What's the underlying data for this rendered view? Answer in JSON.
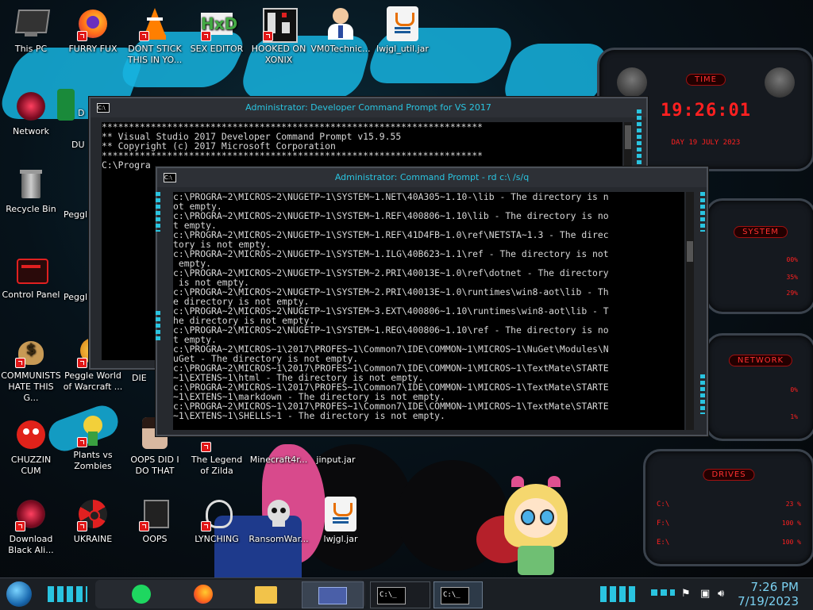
{
  "desktop": {
    "icons": [
      {
        "label": "This PC",
        "icon": "monitor-icon"
      },
      {
        "label": "FURRY FUX",
        "icon": "firefox-icon"
      },
      {
        "label": "DONT STICK THIS IN YO...",
        "icon": "vlc-icon"
      },
      {
        "label": "SEX EDITOR",
        "icon": "hxd-icon"
      },
      {
        "label": "HOOKED ON XONIX",
        "icon": "xonix-icon"
      },
      {
        "label": "VM0Technic...",
        "icon": "doctor-icon"
      },
      {
        "label": "lwjgl_util.jar",
        "icon": "java-jar-icon"
      },
      {
        "label": "Network",
        "icon": "network-icon"
      },
      {
        "label": "Recycle Bin",
        "icon": "recycle-bin-icon"
      },
      {
        "label": "Control Panel",
        "icon": "control-panel-icon"
      },
      {
        "label": "COMMUNISTS HATE THIS G...",
        "icon": "money-bag-icon"
      },
      {
        "label": "Peggle World of Warcraft ...",
        "icon": "peggle-icon"
      },
      {
        "label": "CHUZZIN CUM",
        "icon": "chuzzle-icon"
      },
      {
        "label": "Plants vs Zombies",
        "icon": "plants-icon"
      },
      {
        "label": "OOPS DID I DO THAT",
        "icon": "portrait-icon"
      },
      {
        "label": "The Legend of Zilda",
        "icon": "zelda-icon"
      },
      {
        "label": "Minecraft4r...",
        "icon": "minecraft-icon"
      },
      {
        "label": "jinput.jar",
        "icon": "java-jar-icon"
      },
      {
        "label": "Download Black Ali...",
        "icon": "alienware-icon"
      },
      {
        "label": "UKRAINE",
        "icon": "radiation-icon"
      },
      {
        "label": "OOPS",
        "icon": "oops-icon"
      },
      {
        "label": "LYNCHING",
        "icon": "lynching-icon"
      },
      {
        "label": "RansomWar...",
        "icon": "skull-icon"
      },
      {
        "label": "lwjgl.jar",
        "icon": "java-jar-icon"
      }
    ],
    "partial_labels": [
      "D",
      "DU",
      "Peggl",
      "Peggl",
      "DIE"
    ]
  },
  "gadgets": {
    "time": {
      "title": "TIME",
      "clock": "19:26:01",
      "date": "DAY 19 JULY 2023"
    },
    "system": {
      "title": "SYSTEM",
      "values": [
        "00%",
        "35%",
        "29%"
      ]
    },
    "network": {
      "title": "NETWORK",
      "values": [
        "0%",
        "1%"
      ]
    },
    "drives": {
      "title": "DRIVES",
      "rows": [
        {
          "label": "C:\\",
          "value": "23 %"
        },
        {
          "label": "F:\\",
          "value": "100 %"
        },
        {
          "label": "E:\\",
          "value": "100 %"
        }
      ]
    }
  },
  "windows": {
    "dev_prompt": {
      "title": "Administrator: Developer Command Prompt for VS 2017",
      "lines": [
        "**********************************************************************",
        "** Visual Studio 2017 Developer Command Prompt v15.9.55",
        "** Copyright (c) 2017 Microsoft Corporation",
        "**********************************************************************",
        "",
        "C:\\Progra"
      ]
    },
    "cmd_prompt": {
      "title": "Administrator: Command Prompt - rd  c:\\ /s/q",
      "lines": [
        "c:\\PROGRA~2\\MICROS~2\\NUGETP~1\\SYSTEM~1.NET\\40A305~1.10-\\lib - The directory is n",
        "ot empty.",
        "c:\\PROGRA~2\\MICROS~2\\NUGETP~1\\SYSTEM~1.REF\\400806~1.10\\lib - The directory is no",
        "t empty.",
        "c:\\PROGRA~2\\MICROS~2\\NUGETP~1\\SYSTEM~1.REF\\41D4FB~1.0\\ref\\NETSTA~1.3 - The direc",
        "tory is not empty.",
        "c:\\PROGRA~2\\MICROS~2\\NUGETP~1\\SYSTEM~1.ILG\\40B623~1.1\\ref - The directory is not",
        " empty.",
        "c:\\PROGRA~2\\MICROS~2\\NUGETP~1\\SYSTEM~2.PRI\\40013E~1.0\\ref\\dotnet - The directory",
        " is not empty.",
        "c:\\PROGRA~2\\MICROS~2\\NUGETP~1\\SYSTEM~2.PRI\\40013E~1.0\\runtimes\\win8-aot\\lib - Th",
        "e directory is not empty.",
        "c:\\PROGRA~2\\MICROS~2\\NUGETP~1\\SYSTEM~3.EXT\\400806~1.10\\runtimes\\win8-aot\\lib - T",
        "he directory is not empty.",
        "c:\\PROGRA~2\\MICROS~2\\NUGETP~1\\SYSTEM~1.REG\\400806~1.10\\ref - The directory is no",
        "t empty.",
        "c:\\PROGRA~2\\MICROS~1\\2017\\PROFES~1\\Common7\\IDE\\COMMON~1\\MICROS~1\\NuGet\\Modules\\N",
        "uGet - The directory is not empty.",
        "c:\\PROGRA~2\\MICROS~1\\2017\\PROFES~1\\Common7\\IDE\\COMMON~1\\MICROS~1\\TextMate\\STARTE",
        "~1\\EXTENS~1\\html - The directory is not empty.",
        "c:\\PROGRA~2\\MICROS~1\\2017\\PROFES~1\\Common7\\IDE\\COMMON~1\\MICROS~1\\TextMate\\STARTE",
        "~1\\EXTENS~1\\markdown - The directory is not empty.",
        "c:\\PROGRA~2\\MICROS~1\\2017\\PROFES~1\\Common7\\IDE\\COMMON~1\\MICROS~1\\TextMate\\STARTE",
        "~1\\EXTENS~1\\SHELLS~1 - The directory is not empty."
      ]
    }
  },
  "taskbar": {
    "buttons": [
      {
        "icon": "start-orb-icon"
      },
      {
        "icon": "spotify-icon"
      },
      {
        "icon": "firefox-icon"
      },
      {
        "icon": "file-explorer-icon"
      },
      {
        "icon": "control-panel-app-icon"
      },
      {
        "icon": "cmd-icon",
        "text": "C:\\_"
      },
      {
        "icon": "cmd-icon",
        "text": "C:\\_"
      }
    ],
    "time": "7:26 PM",
    "date": "7/19/2023"
  },
  "colors": {
    "accent_cyan": "#2ac4e0",
    "gadget_red": "#ff2020",
    "console_bg": "#000000",
    "console_text": "#d8d8d8"
  }
}
